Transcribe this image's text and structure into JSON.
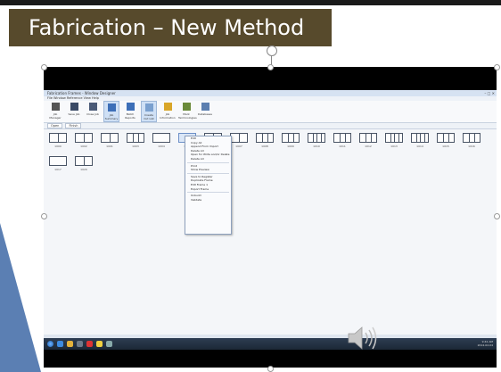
{
  "slide": {
    "title": "Fabrication – New Method",
    "colors": {
      "title_bg": "#574a2c",
      "accent": "#5b7fb3"
    }
  },
  "screenshot": {
    "window_title": "Fabrication Frames - Window Designer",
    "window_controls": "– □ ✕",
    "menu": "File  Window  Reference  View  Help",
    "ribbon": [
      {
        "label": "Job Manager",
        "icon": "hammer-icon"
      },
      {
        "label": "Save Job",
        "icon": "save-icon"
      },
      {
        "label": "Close Job",
        "icon": "close-job-icon"
      },
      {
        "label": "Job Summary",
        "icon": "grid-icon",
        "selected": true
      },
      {
        "label": "Batch Reports",
        "icon": "grid-icon"
      },
      {
        "label": "Create Cut List",
        "icon": "window-icon",
        "selected": true
      },
      {
        "label": "Job Information",
        "icon": "info-icon"
      },
      {
        "label": "Mark Terminologies",
        "icon": "gear-icon"
      },
      {
        "label": "Databases",
        "icon": "database-icon"
      }
    ],
    "tabs": [
      "Open",
      "Finish"
    ],
    "thumb_labels": [
      "1000",
      "1002",
      "1001",
      "1003",
      "1004",
      "1005",
      "1006",
      "1007",
      "1008",
      "1009",
      "1010",
      "1011",
      "1012",
      "1013",
      "1014",
      "1015",
      "1016",
      "1017",
      "1020"
    ],
    "context_menu": [
      "Edit",
      "Copy All",
      "Append From Import",
      "Delete All",
      "Open for Write and/or Delete",
      "Delete All",
      "---",
      "Print",
      "Show Preview",
      "---",
      "Save to Register",
      "Duplicate Frame",
      "Edit Frame 1",
      "Export Frame",
      "---",
      "Unbuild",
      "Validate"
    ],
    "tray_time": "9:41 AM",
    "tray_date": "2014-02-04"
  }
}
